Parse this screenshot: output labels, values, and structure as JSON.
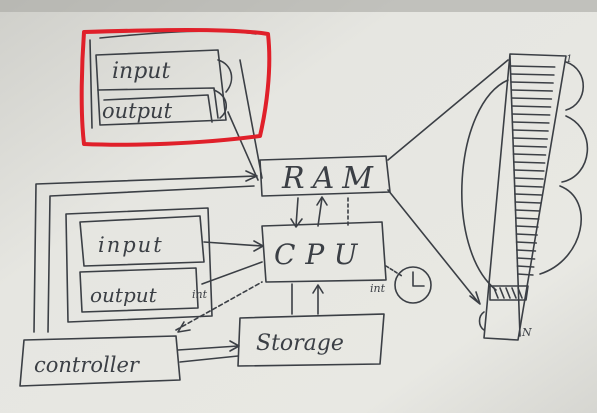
{
  "board": {
    "colors": {
      "background": "#e4e4df",
      "ink": "#3b3f45",
      "highlight": "#e0202a"
    },
    "labels": {
      "input_top": "input",
      "output_top": "output",
      "ram": "RAM",
      "cpu": "CPU",
      "input_mid": "input",
      "output_mid": "output",
      "int_left": "int",
      "int_right": "int",
      "storage": "Storage",
      "controller": "controller",
      "tape_top": "1",
      "tape_bottom": "N"
    },
    "icons": [
      "clock-icon"
    ]
  }
}
